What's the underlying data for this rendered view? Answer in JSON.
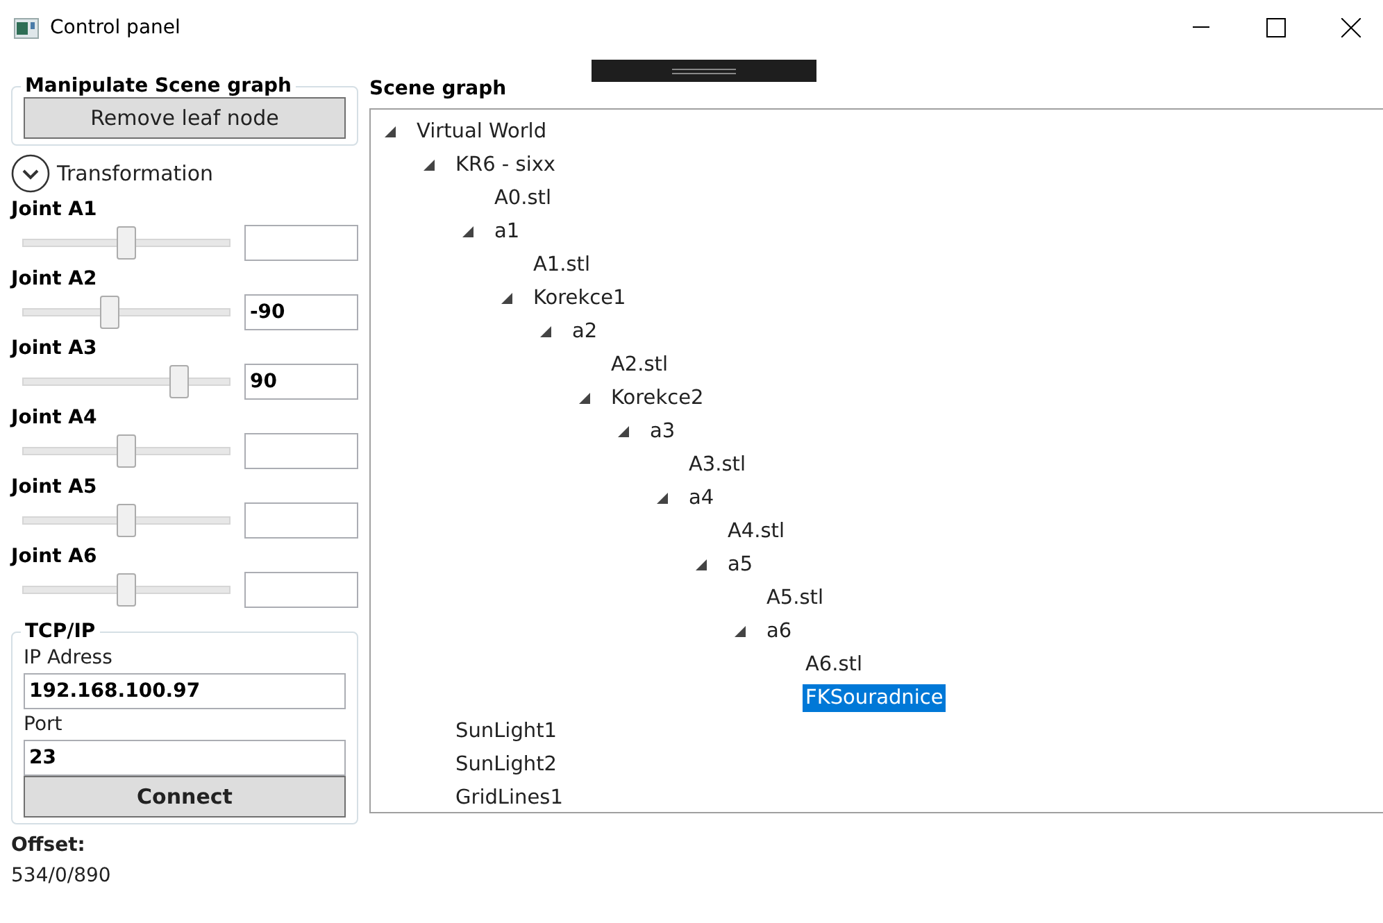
{
  "window": {
    "title": "Control panel"
  },
  "manipulate": {
    "title": "Manipulate Scene graph",
    "button": "Remove leaf node"
  },
  "transformation": {
    "label": "Transformation",
    "expanded": true
  },
  "joints": [
    {
      "label": "Joint A1",
      "level": 0.5
    },
    {
      "label": "Joint A2",
      "level": 0.42,
      "value": "-90"
    },
    {
      "label": "Joint A3",
      "level": 0.75,
      "value": "90"
    },
    {
      "label": "Joint A4",
      "level": 0.5
    },
    {
      "label": "Joint A5",
      "level": 0.5
    },
    {
      "label": "Joint A6",
      "level": 0.5
    }
  ],
  "tcp": {
    "title": "TCP/IP",
    "ip_label": "IP Adress",
    "ip": "192.168.100.97",
    "port_label": "Port",
    "port": "23",
    "button": "Connect"
  },
  "offset": {
    "label": "Offset:",
    "value": "534/0/890"
  },
  "scene_graph": {
    "title": "Scene graph",
    "tree": [
      {
        "label": "Virtual World",
        "expanded": true,
        "selected": false,
        "children": [
          {
            "label": "KR6 - sixx",
            "expanded": true,
            "selected": false,
            "children": [
              {
                "label": "A0.stl",
                "selected": false
              },
              {
                "label": "a1",
                "expanded": true,
                "selected": false,
                "children": [
                  {
                    "label": "A1.stl",
                    "selected": false
                  },
                  {
                    "label": "Korekce1",
                    "expanded": true,
                    "selected": false,
                    "children": [
                      {
                        "label": "a2",
                        "expanded": true,
                        "selected": false,
                        "children": [
                          {
                            "label": "A2.stl",
                            "selected": false
                          },
                          {
                            "label": "Korekce2",
                            "expanded": true,
                            "selected": false,
                            "children": [
                              {
                                "label": "a3",
                                "expanded": true,
                                "selected": false,
                                "children": [
                                  {
                                    "label": "A3.stl",
                                    "selected": false
                                  },
                                  {
                                    "label": "a4",
                                    "expanded": true,
                                    "selected": false,
                                    "children": [
                                      {
                                        "label": "A4.stl",
                                        "selected": false
                                      },
                                      {
                                        "label": "a5",
                                        "expanded": true,
                                        "selected": false,
                                        "children": [
                                          {
                                            "label": "A5.stl",
                                            "selected": false
                                          },
                                          {
                                            "label": "a6",
                                            "expanded": true,
                                            "selected": false,
                                            "children": [
                                              {
                                                "label": "A6.stl",
                                                "selected": false
                                              },
                                              {
                                                "label": "FKSouradnice",
                                                "selected": true
                                              }
                                            ]
                                          }
                                        ]
                                      }
                                    ]
                                  }
                                ]
                              }
                            ]
                          }
                        ]
                      }
                    ]
                  }
                ]
              }
            ]
          },
          {
            "label": "SunLight1",
            "selected": false
          },
          {
            "label": "SunLight2",
            "selected": false
          },
          {
            "label": "GridLines1",
            "selected": false
          }
        ]
      }
    ]
  }
}
